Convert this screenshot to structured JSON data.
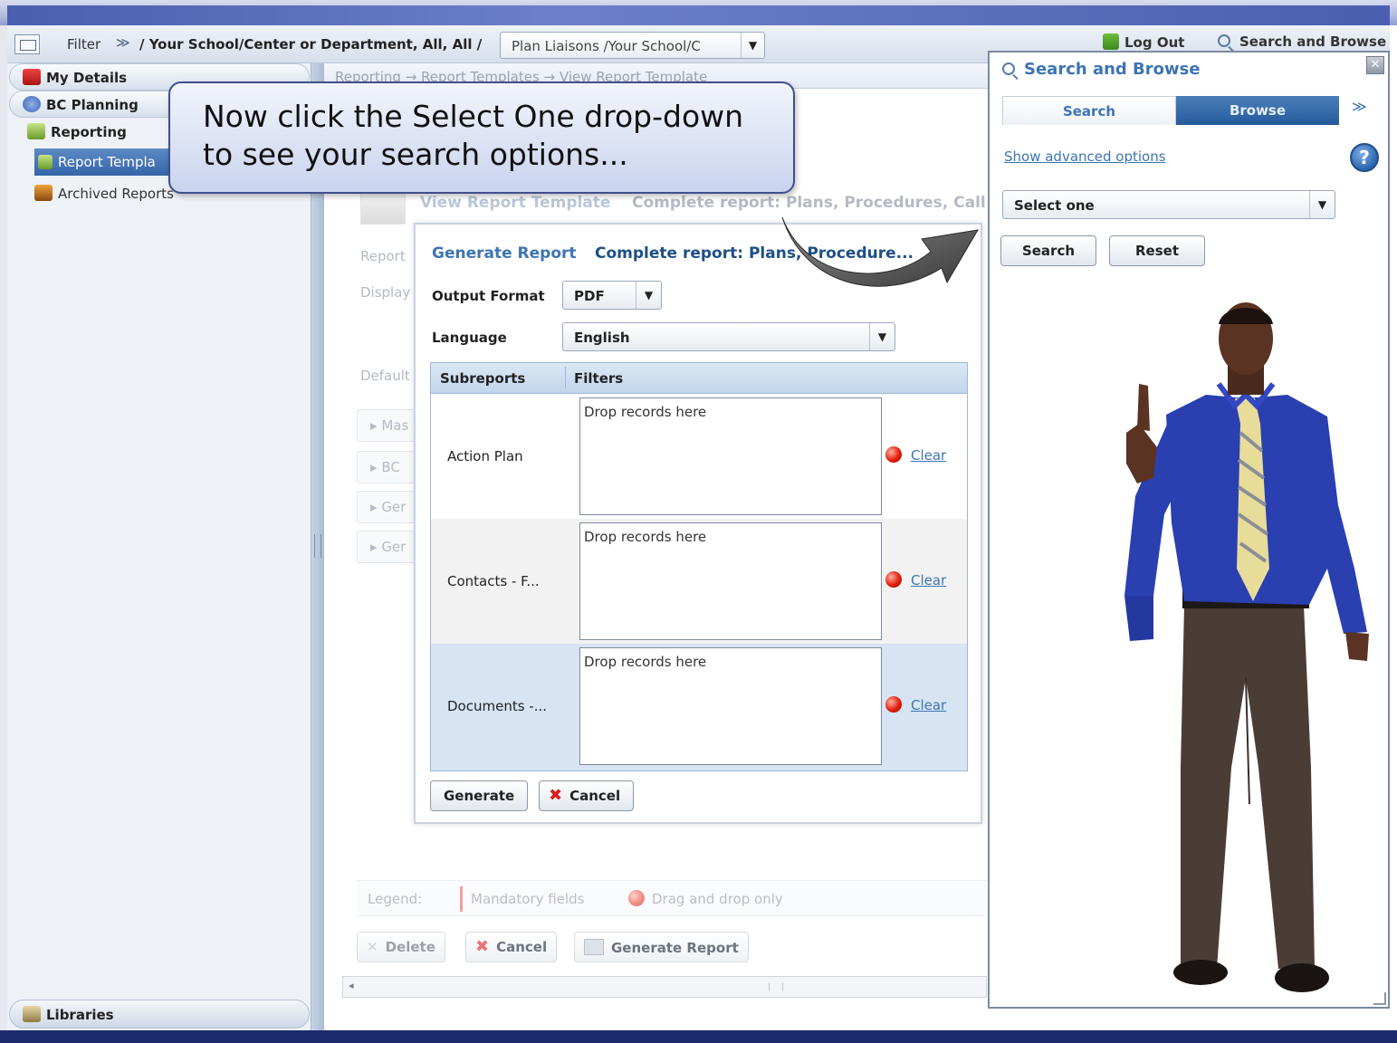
{
  "topbar": {
    "filter_label": "Filter",
    "breadcrumb": "/ Your School/Center or Department, All, All /",
    "plan_select_value": "Plan Liaisons /Your School/C",
    "logout_label": "Log Out",
    "search_browse_label": "Search and Browse"
  },
  "sidebar": {
    "items": [
      {
        "label": "My Details"
      },
      {
        "label": "BC Planning"
      },
      {
        "label": "Reporting"
      },
      {
        "label": "Report Templa"
      },
      {
        "label": "Archived Reports"
      }
    ],
    "libraries_label": "Libraries"
  },
  "main": {
    "breadcrumb_text": "Reporting → Report Templates → View Report Template",
    "faded_title1": "View Report Template",
    "faded_title2": "Complete report: Plans, Procedures, Call",
    "faded_labels": [
      "Report",
      "Display",
      "Default"
    ],
    "sections": [
      "Mas",
      "BC",
      "Ger",
      "Ger"
    ],
    "legend_label": "Legend:",
    "legend_mandatory": "Mandatory fields",
    "legend_dragdrop": "Drag and drop only",
    "btn_delete": "Delete",
    "btn_cancel": "Cancel",
    "btn_generate_report": "Generate Report"
  },
  "dialog": {
    "title": "Generate Report",
    "subtitle": "Complete report: Plans, Procedure...",
    "output_format_label": "Output Format",
    "output_format_value": "PDF",
    "language_label": "Language",
    "language_value": "English",
    "col_subreports": "Subreports",
    "col_filters": "Filters",
    "rows": [
      {
        "label": "Action Plan",
        "drop": "Drop records here",
        "clear": "Clear"
      },
      {
        "label": "Contacts - F...",
        "drop": "Drop records here",
        "clear": "Clear"
      },
      {
        "label": "Documents -...",
        "drop": "Drop records here",
        "clear": "Clear"
      }
    ],
    "generate_label": "Generate",
    "cancel_label": "Cancel"
  },
  "search_panel": {
    "title": "Search and Browse",
    "tab_search": "Search",
    "tab_browse": "Browse",
    "advanced_link": "Show advanced options",
    "select_value": "Select one",
    "search_btn": "Search",
    "reset_btn": "Reset"
  },
  "callout": {
    "line1": "Now click the Select One drop-down",
    "line2": "to see your search options..."
  },
  "colors": {
    "accent": "#3d74b3",
    "browse_tab": "#245a9c",
    "clear_icon": "#e21d0c"
  }
}
